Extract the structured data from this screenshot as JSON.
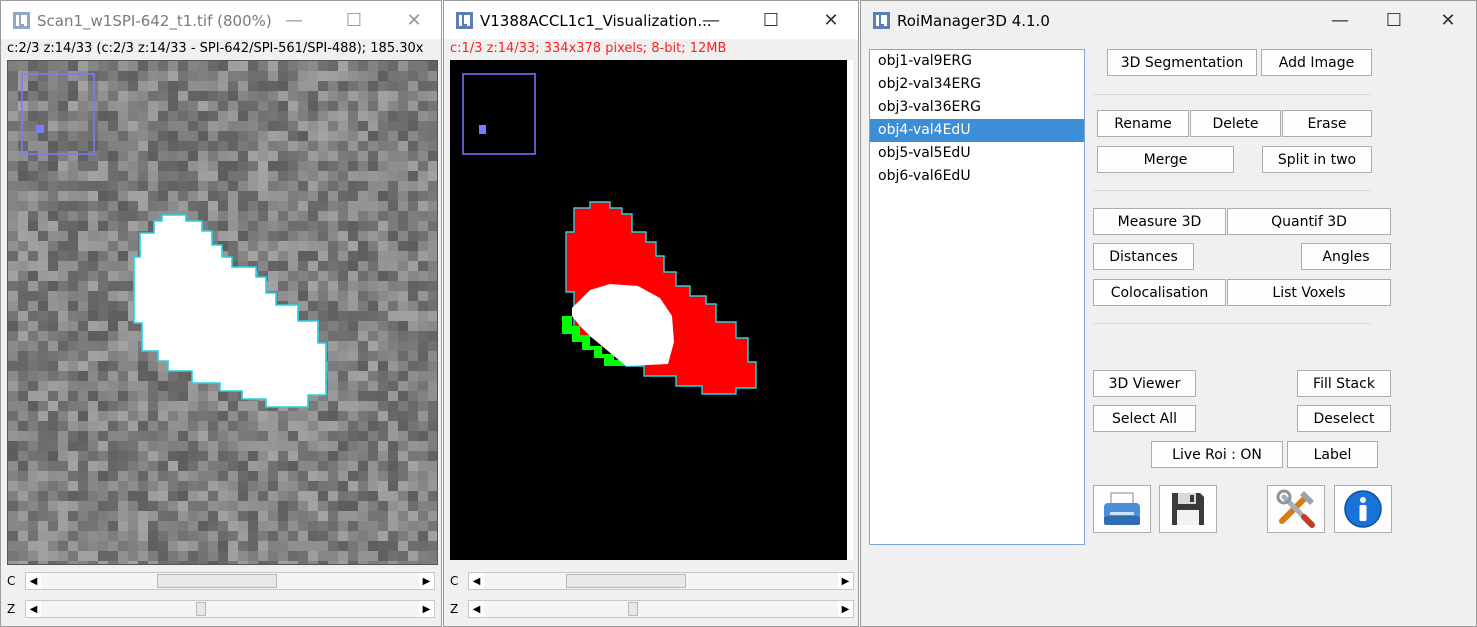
{
  "win1": {
    "title": "Scan1_w1SPI-642_t1.tif (800%)",
    "info": "c:2/3 z:14/33 (c:2/3 z:14/33 - SPI-642/SPI-561/SPI-488); 185.30x",
    "scroll_c_label": "C",
    "scroll_z_label": "Z",
    "scroll_c_thumb": 0.45,
    "scroll_z_thumb": 0.42
  },
  "win2": {
    "title": "V1388ACCL1c1_Visualization...",
    "info": "c:1/3 z:14/33; 334x378 pixels; 8-bit; 12MB",
    "scroll_c_label": "C",
    "scroll_z_label": "Z",
    "scroll_c_thumb": 0.35,
    "scroll_z_thumb": 0.42
  },
  "roimanager": {
    "title": "RoiManager3D 4.1.0",
    "objects": [
      "obj1-val9ERG",
      "obj2-val34ERG",
      "obj3-val36ERG",
      "obj4-val4EdU",
      "obj5-val5EdU",
      "obj6-val6EdU"
    ],
    "selected_object": "obj4-val4EdU",
    "buttons": {
      "segmentation": "3D Segmentation",
      "add_image": "Add Image",
      "rename": "Rename",
      "delete": "Delete",
      "erase": "Erase",
      "merge": "Merge",
      "split": "Split in two",
      "measure": "Measure 3D",
      "quantif": "Quantif 3D",
      "distances": "Distances",
      "angles": "Angles",
      "colocalisation": "Colocalisation",
      "list_voxels": "List Voxels",
      "viewer": "3D Viewer",
      "fill_stack": "Fill Stack",
      "select_all": "Select All",
      "deselect": "Deselect",
      "live_roi": "Live Roi : ON",
      "label": "Label"
    },
    "icons": [
      "printer-icon",
      "save-icon",
      "tools-icon",
      "info-icon"
    ]
  },
  "colors": {
    "selection": "#3c8ed6",
    "roi_outline": "#22d3e6",
    "red_object": "#ff0000",
    "green_object": "#00ff00",
    "info_red": "#ff2020",
    "thumbnail_box": "#7b7bff"
  }
}
